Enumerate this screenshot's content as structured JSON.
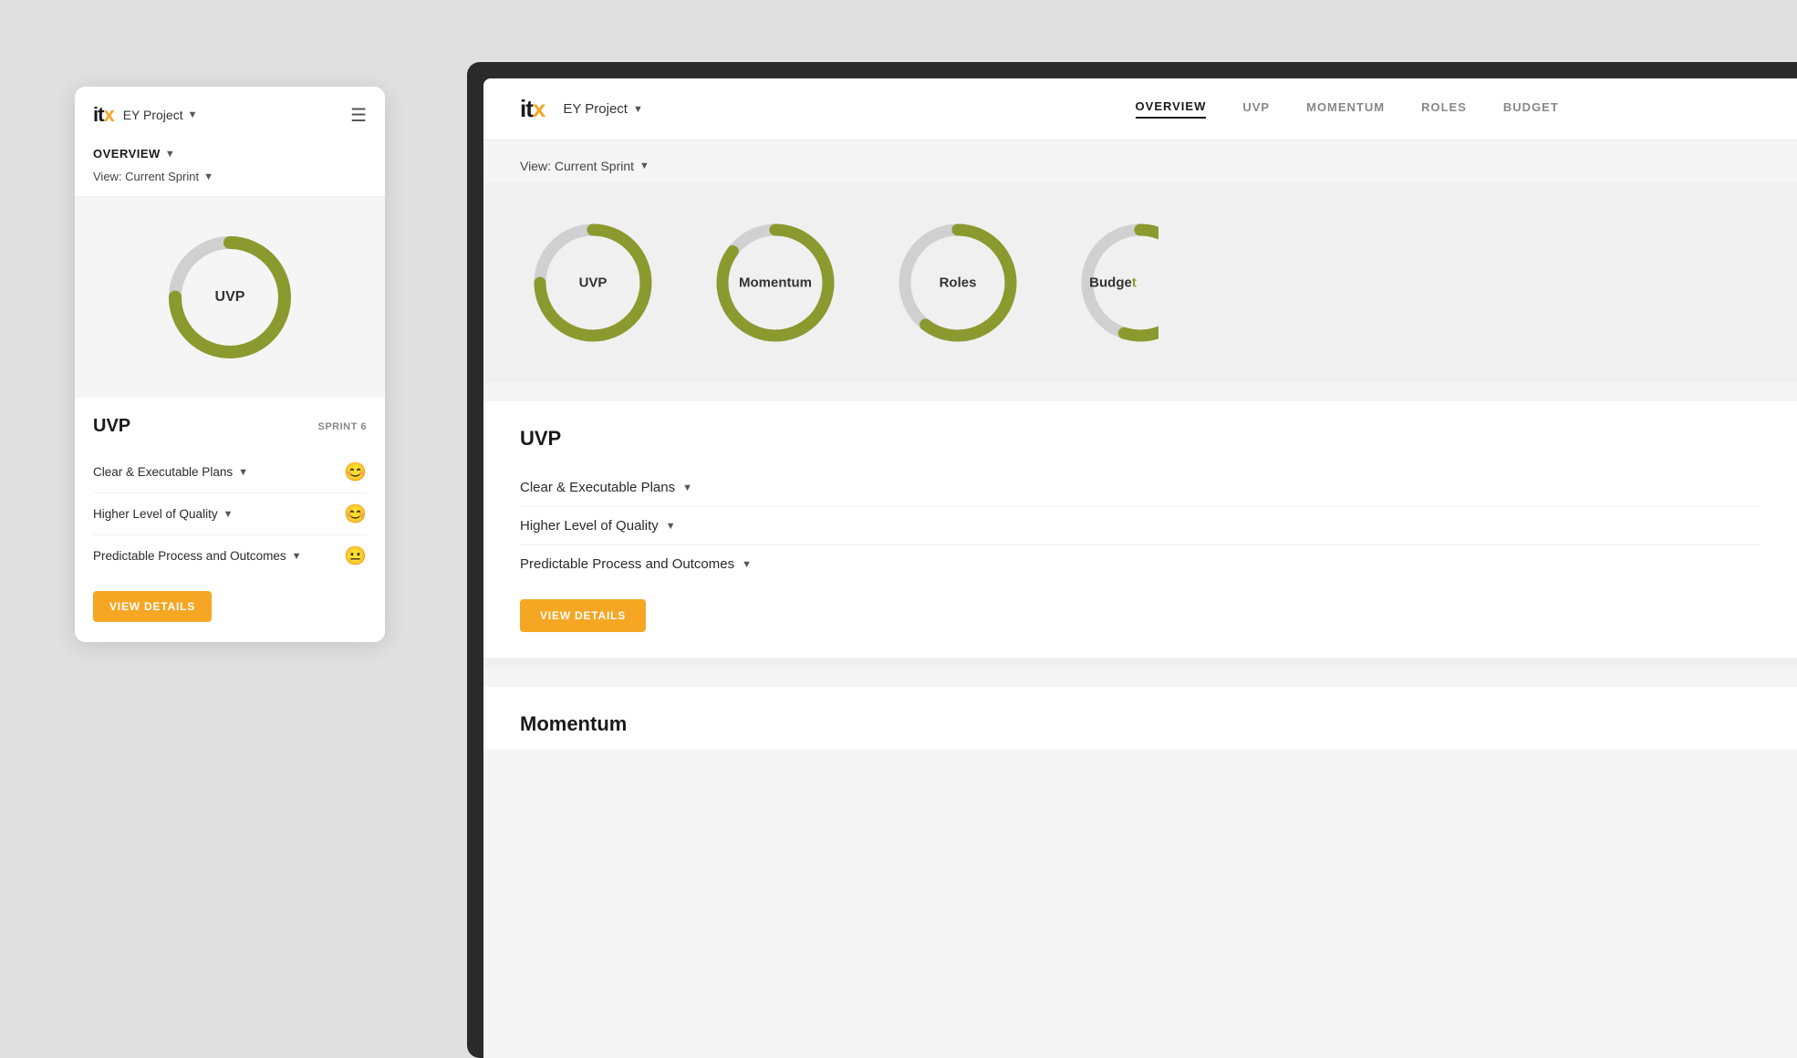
{
  "brand": {
    "logo_text": "it",
    "logo_x": "x",
    "accent_color": "#f5a623",
    "olive_color": "#8a9a2e",
    "gray_color": "#d0d0d0"
  },
  "mobile": {
    "project_label": "EY Project",
    "hamburger": "≡",
    "nav_title": "OVERVIEW",
    "view_label": "View: Current Sprint",
    "donut_label": "UVP",
    "uvp_section": {
      "title": "UVP",
      "sprint_badge": "SPRINT 6",
      "items": [
        {
          "label": "Clear & Executable Plans",
          "emoji": "😊",
          "status": "happy"
        },
        {
          "label": "Higher Level of Quality",
          "emoji": "😊",
          "status": "happy"
        },
        {
          "label": "Predictable Process and Outcomes",
          "emoji": "😐",
          "status": "neutral"
        }
      ],
      "button_label": "VIEW DETAILS"
    }
  },
  "desktop": {
    "project_label": "EY Project",
    "nav_items": [
      {
        "label": "OVERVIEW",
        "active": true
      },
      {
        "label": "UVP",
        "active": false
      },
      {
        "label": "MOMENTUM",
        "active": false
      },
      {
        "label": "ROLES",
        "active": false
      },
      {
        "label": "BUDGET",
        "active": false
      }
    ],
    "view_label": "View: Current Sprint",
    "charts": [
      {
        "label": "UVP",
        "fill_pct": 75,
        "gap_pct": 25
      },
      {
        "label": "Momentum",
        "fill_pct": 85,
        "gap_pct": 15
      },
      {
        "label": "Roles",
        "fill_pct": 60,
        "gap_pct": 40
      },
      {
        "label": "Budget",
        "fill_pct": 50,
        "gap_pct": 50
      }
    ],
    "uvp_card": {
      "title": "UVP",
      "items": [
        {
          "label": "Clear & Executable Plans"
        },
        {
          "label": "Higher Level of Quality"
        },
        {
          "label": "Predictable Process and Outcomes"
        }
      ],
      "button_label": "VIEW DETAILS"
    },
    "momentum_section": {
      "title": "Momentum"
    }
  }
}
